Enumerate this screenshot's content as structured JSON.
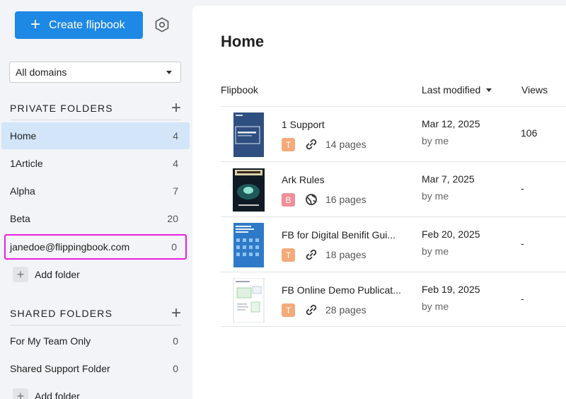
{
  "sidebar": {
    "create_label": "Create flipbook",
    "domain_selected": "All domains",
    "private_header": "PRIVATE FOLDERS",
    "private_folders": [
      {
        "label": "Home",
        "count": "4"
      },
      {
        "label": "1Article",
        "count": "4"
      },
      {
        "label": "Alpha",
        "count": "7"
      },
      {
        "label": "Beta",
        "count": "20"
      },
      {
        "label": "janedoe@flippingbook.com",
        "count": "0"
      }
    ],
    "add_folder_label": "Add folder",
    "shared_header": "SHARED FOLDERS",
    "shared_folders": [
      {
        "label": "For My Team Only",
        "count": "0"
      },
      {
        "label": "Shared Support Folder",
        "count": "0"
      }
    ],
    "add_folder_label_2": "Add folder"
  },
  "main": {
    "title": "Home",
    "columns": {
      "flipbook": "Flipbook",
      "last_modified": "Last modified",
      "views": "Views"
    },
    "rows": [
      {
        "title": "1 Support",
        "badge": "T",
        "badge_color": "#f4a97a",
        "link_icon": "link-icon",
        "pages": "14 pages",
        "date": "Mar 12, 2025",
        "by": "by me",
        "views": "106"
      },
      {
        "title": "Ark Rules",
        "badge": "B",
        "badge_color": "#ef8f97",
        "link_icon": "globe-icon",
        "pages": "16 pages",
        "date": "Mar 7, 2025",
        "by": "by me",
        "views": "-"
      },
      {
        "title": "FB for Digital Benifit Gui...",
        "badge": "T",
        "badge_color": "#f4a97a",
        "link_icon": "link-icon",
        "pages": "18 pages",
        "date": "Feb 20, 2025",
        "by": "by me",
        "views": "-"
      },
      {
        "title": "FB Online Demo Publicat...",
        "badge": "T",
        "badge_color": "#f4a97a",
        "link_icon": "link-icon",
        "pages": "28 pages",
        "date": "Feb 19, 2025",
        "by": "by me",
        "views": "-"
      }
    ]
  },
  "colors": {
    "accent": "#1e88e5",
    "active_folder": "#d3e5f9",
    "highlight": "#e91ee0"
  }
}
